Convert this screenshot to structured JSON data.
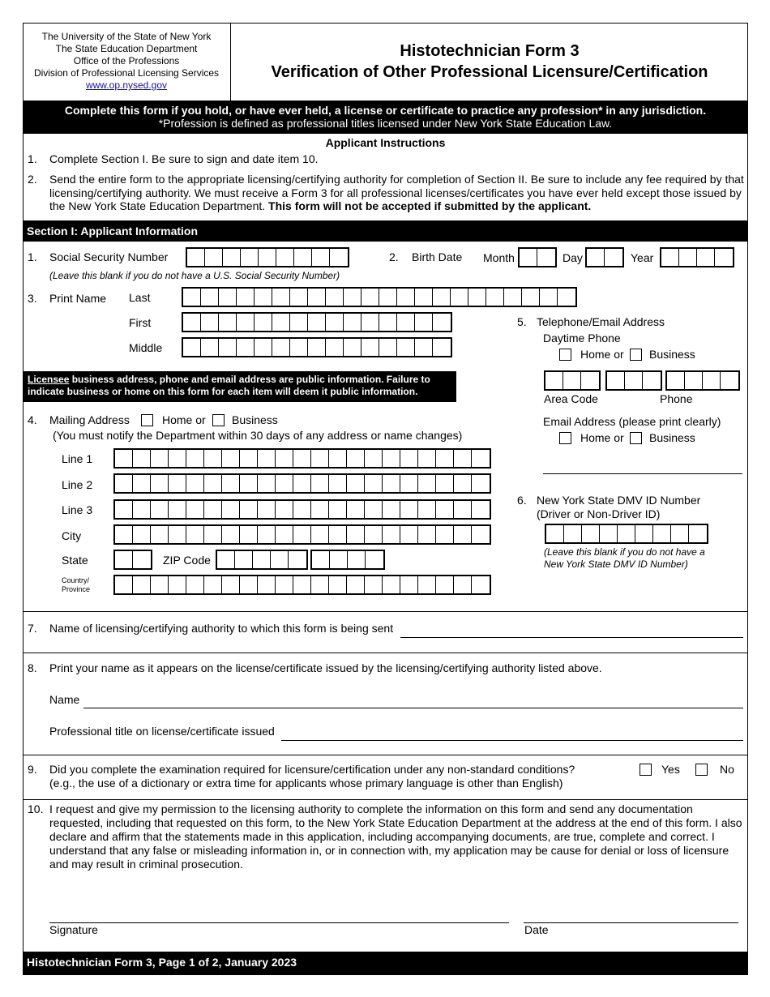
{
  "header": {
    "org_lines": [
      "The University of the State of New York",
      "The State Education Department",
      "Office of the Professions",
      "Division of Professional Licensing Services"
    ],
    "website": "www.op.nysed.gov",
    "title_line1": "Histotechnician Form 3",
    "title_line2": "Verification of Other Professional Licensure/Certification"
  },
  "banner": {
    "line1": "Complete this form if you hold, or have ever held, a license or certificate to practice any profession* in any jurisdiction.",
    "line2": "*Profession is defined as professional titles licensed under New York State Education Law."
  },
  "instructions": {
    "title": "Applicant Instructions",
    "items": [
      {
        "num": "1.",
        "text": "Complete Section I. Be sure to sign and date item 10.",
        "bold": ""
      },
      {
        "num": "2.",
        "text": "Send the entire form to the appropriate licensing/certifying authority for completion of Section II. Be sure to include any fee required by that licensing/certifying authority. We must receive a Form 3 for all professional licenses/certificates you have ever held except those issued by the New York State Education Department. ",
        "bold": "This form will not be accepted if submitted by the applicant."
      }
    ]
  },
  "section1": {
    "title": "Section I: Applicant Information",
    "ssn": {
      "num": "1.",
      "label": "Social Security Number",
      "note": "(Leave this blank if you do not have a U.S. Social Security Number)",
      "cells": 9
    },
    "birth": {
      "num": "2.",
      "label": "Birth Date",
      "month": "Month",
      "day": "Day",
      "year": "Year"
    },
    "name": {
      "num": "3.",
      "label": "Print Name",
      "last": "Last",
      "first": "First",
      "middle": "Middle",
      "last_cells": 22,
      "first_cells": 15,
      "middle_cells": 15
    },
    "notice": {
      "underlined": "Licensee",
      "text": " business address, phone and email address are public information. Failure to indicate business or home on this form for each item will deem it public information."
    },
    "mailing": {
      "num": "4.",
      "label": "Mailing Address",
      "home": "Home or",
      "business": "Business",
      "note": "(You must notify the Department within 30 days of any address or name changes)",
      "line1": "Line 1",
      "line2": "Line 2",
      "line3": "Line 3",
      "city": "City",
      "state": "State",
      "zip": "ZIP Code",
      "country_line1": "Country/",
      "country_line2": "Province",
      "cells": 21
    },
    "phone": {
      "num": "5.",
      "label": "Telephone/Email Address",
      "daytime": "Daytime Phone",
      "home": "Home or",
      "business": "Business",
      "area_code": "Area Code",
      "phone": "Phone",
      "email_label": "Email Address (please print clearly)",
      "email_home": "Home or",
      "email_business": "Business"
    },
    "dmv": {
      "num": "6.",
      "label": "New York State DMV ID Number",
      "sub": "(Driver or Non-Driver ID)",
      "note_line1": "(Leave this blank if you do not have a",
      "note_line2": "New York State DMV ID Number)",
      "cells": 9
    },
    "q7": {
      "num": "7.",
      "label": "Name of licensing/certifying authority to which this form is being sent"
    },
    "q8": {
      "num": "8.",
      "label": "Print your name as it appears on the license/certificate issued by the licensing/certifying authority listed above.",
      "name": "Name",
      "title": "Professional title on license/certificate issued"
    },
    "q9": {
      "num": "9.",
      "line1": "Did you complete the examination required for licensure/certification under any non-standard conditions?",
      "line2": "(e.g., the use of a dictionary or extra time for applicants whose primary language is other than English)",
      "yes": "Yes",
      "no": "No"
    },
    "q10": {
      "num": "10.",
      "text": "I request and give my permission to the licensing authority to complete the information on this form and send any documentation requested, including that requested on this form, to the New York State Education Department at the address at the end of this form. I also declare and affirm that the statements made in this application, including accompanying documents, are true, complete and correct. I understand that any false or misleading information in, or in connection with, my application may be cause for denial or loss of licensure and may result in criminal prosecution.",
      "signature": "Signature",
      "date": "Date"
    }
  },
  "footer": {
    "text": "Histotechnician Form 3, Page 1 of 2, January 2023"
  }
}
